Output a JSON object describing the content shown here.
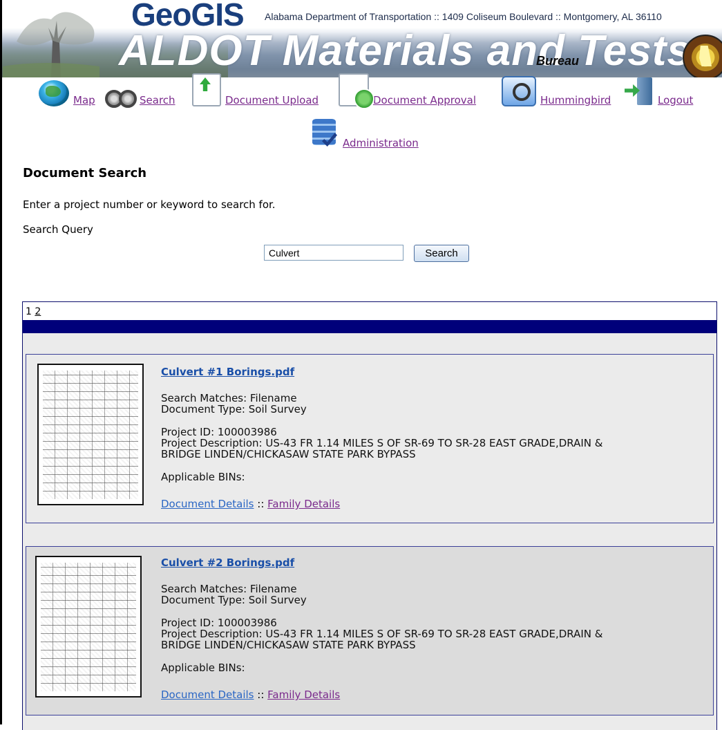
{
  "header": {
    "logo_text": "GeoGIS",
    "department": "Alabama Department of Transportation :: 1409 Coliseum Boulevard :: Montgomery, AL 36110",
    "title": "ALDOT Materials and Tests",
    "subtitle": "Bureau"
  },
  "nav": {
    "items": [
      {
        "label": "Map",
        "icon": "globe-icon"
      },
      {
        "label": "Search",
        "icon": "binoculars-icon"
      },
      {
        "label": "Document Upload",
        "icon": "upload-icon"
      },
      {
        "label": "Document Approval",
        "icon": "approval-icon"
      },
      {
        "label": "Hummingbird",
        "icon": "hummingbird-icon"
      },
      {
        "label": "Logout",
        "icon": "logout-icon"
      },
      {
        "label": "Administration",
        "icon": "admin-icon"
      }
    ],
    "link_color": "#7a2a8c"
  },
  "search": {
    "heading": "Document Search",
    "instructions": "Enter a project number or keyword to search for.",
    "query_label": "Search Query",
    "query_value": "Culvert",
    "button_label": "Search"
  },
  "results": {
    "pages": [
      "1",
      "2"
    ],
    "current_page": "1",
    "band_color": "#00007a",
    "items": [
      {
        "title": "Culvert #1 Borings.pdf",
        "search_matches": "Search Matches: Filename",
        "document_type": "Document Type: Soil Survey",
        "project_id": "Project ID: 100003986",
        "project_description_1": "Project Description: US-43 FR 1.14 MILES S OF SR-69 TO SR-28 EAST GRADE,DRAIN &",
        "project_description_2": "BRIDGE LINDEN/CHICKASAW STATE PARK BYPASS",
        "applicable_bins": "Applicable BINs:",
        "document_details": "Document Details",
        "separator": "::",
        "family_details": "Family Details",
        "background": "#ebebeb"
      },
      {
        "title": "Culvert #2 Borings.pdf",
        "search_matches": "Search Matches: Filename",
        "document_type": "Document Type: Soil Survey",
        "project_id": "Project ID: 100003986",
        "project_description_1": "Project Description: US-43 FR 1.14 MILES S OF SR-69 TO SR-28 EAST GRADE,DRAIN &",
        "project_description_2": "BRIDGE LINDEN/CHICKASAW STATE PARK BYPASS",
        "applicable_bins": "Applicable BINs:",
        "document_details": "Document Details",
        "separator": "::",
        "family_details": "Family Details",
        "background": "#dcdcdc"
      }
    ]
  }
}
